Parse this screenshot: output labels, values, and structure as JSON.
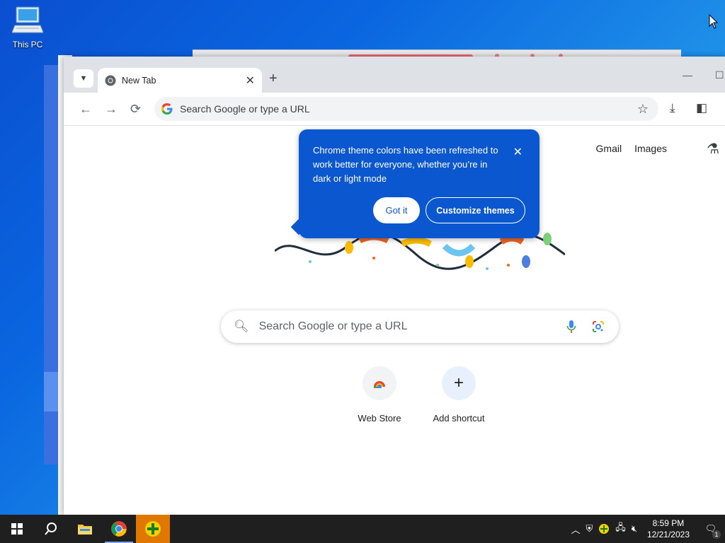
{
  "desktop": {
    "icons": [
      {
        "label": "This PC",
        "icon": "computer-icon"
      }
    ]
  },
  "browser": {
    "tab": {
      "title": "New Tab",
      "icon": "chrome-icon"
    },
    "omnibox": {
      "placeholder": "Search Google or type a URL"
    },
    "top_links": [
      "Gmail",
      "Images"
    ],
    "search": {
      "placeholder": "Search Google or type a URL"
    },
    "shortcuts": [
      {
        "label": "Web Store",
        "icon": "web-store-icon"
      },
      {
        "label": "Add shortcut",
        "icon": "plus-icon"
      }
    ],
    "promo": {
      "text": "Chrome theme colors have been refreshed to work better for everyone, whether you’re in dark or light mode",
      "got_it": "Got it",
      "customize": "Customize themes",
      "bg_color": "#0b57d0"
    }
  },
  "taskbar": {
    "apps": [
      "start-icon",
      "search-icon",
      "file-explorer-icon",
      "chrome-icon",
      "app-plus-icon"
    ],
    "time": "8:59 PM",
    "date": "12/21/2023",
    "notification_count": "1"
  }
}
